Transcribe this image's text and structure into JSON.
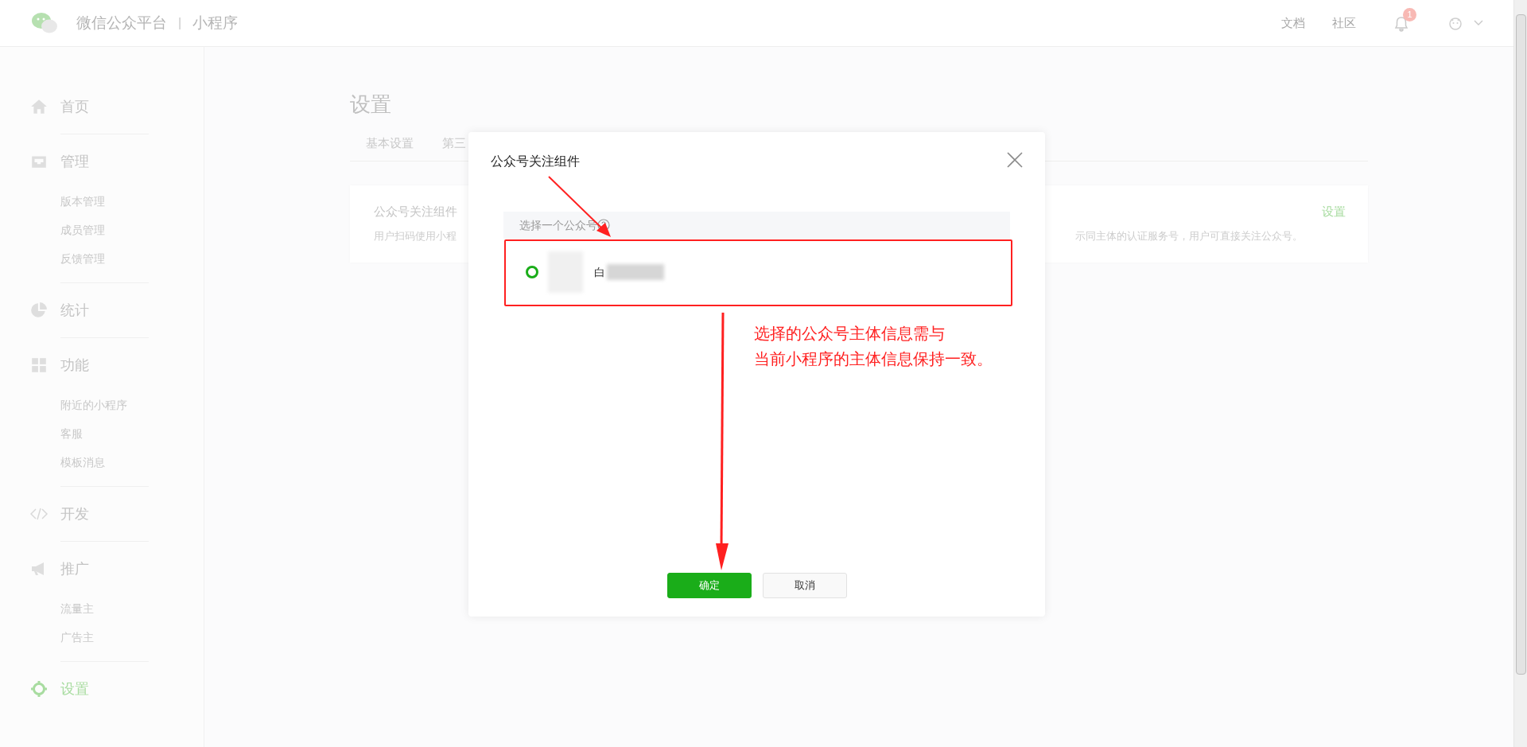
{
  "header": {
    "platform": "微信公众平台",
    "separator": "|",
    "product": "小程序",
    "links": [
      "文档",
      "社区"
    ],
    "notification_count": "1"
  },
  "sidebar": {
    "items": [
      {
        "label": "首页",
        "selected": false
      },
      {
        "label": "管理",
        "selected": false,
        "children": [
          {
            "label": "版本管理",
            "selected": false
          },
          {
            "label": "成员管理",
            "selected": false
          },
          {
            "label": "反馈管理",
            "selected": false
          }
        ]
      },
      {
        "label": "统计",
        "selected": false
      },
      {
        "label": "功能",
        "selected": false,
        "children": [
          {
            "label": "附近的小程序",
            "selected": false
          },
          {
            "label": "客服",
            "selected": false
          },
          {
            "label": "模板消息",
            "selected": false
          }
        ]
      },
      {
        "label": "开发",
        "selected": false
      },
      {
        "label": "推广",
        "selected": false,
        "children": [
          {
            "label": "流量主",
            "selected": false
          },
          {
            "label": "广告主",
            "selected": false
          }
        ]
      },
      {
        "label": "设置",
        "selected": true
      }
    ]
  },
  "page": {
    "title": "设置",
    "tabs": [
      "基本设置",
      "第三"
    ],
    "card": {
      "title": "公众号关注组件",
      "description_start": "用户扫码使用小程",
      "description_end": "示同主体的认证服务号，用户可直接关注公众号。",
      "action": "设置"
    }
  },
  "dialog": {
    "title": "公众号关注组件",
    "section_label": "选择一个公众号",
    "options": [
      {
        "name": "白",
        "selected": true
      }
    ],
    "buttons": [
      {
        "label": "确定",
        "kind": "primary"
      },
      {
        "label": "取消",
        "kind": "default"
      }
    ]
  },
  "annotation": {
    "note": [
      "选择的公众号主体信息需与",
      "当前小程序的主体信息保持一致。"
    ]
  }
}
